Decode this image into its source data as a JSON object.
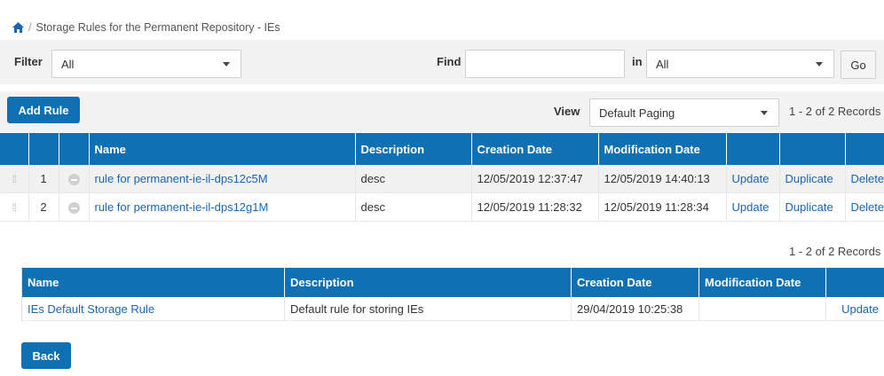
{
  "breadcrumb": {
    "separator": "/",
    "title": "Storage Rules for the Permanent Repository - IEs"
  },
  "filter": {
    "label": "Filter",
    "value": "All"
  },
  "find": {
    "label": "Find",
    "value": "",
    "in_label": "in",
    "in_value": "All",
    "go_label": "Go"
  },
  "toolbar": {
    "add_rule_label": "Add Rule",
    "view_label": "View",
    "view_value": "Default Paging",
    "records_top": "1 - 2 of 2 Records"
  },
  "rules_table": {
    "headers": [
      "Name",
      "Description",
      "Creation Date",
      "Modification Date"
    ],
    "rows": [
      {
        "index": "1",
        "name": "rule for permanent-ie-il-dps12c5M",
        "description": "desc",
        "created": "12/05/2019 12:37:47",
        "modified": "12/05/2019 14:40:13",
        "update": "Update",
        "duplicate": "Duplicate",
        "delete": "Delete"
      },
      {
        "index": "2",
        "name": "rule for permanent-ie-il-dps12g1M",
        "description": "desc",
        "created": "12/05/2019 11:28:32",
        "modified": "12/05/2019 11:28:34",
        "update": "Update",
        "duplicate": "Duplicate",
        "delete": "Delete"
      }
    ]
  },
  "records_bottom": "1 - 2 of 2 Records",
  "default_table": {
    "headers": [
      "Name",
      "Description",
      "Creation Date",
      "Modification Date"
    ],
    "rows": [
      {
        "name": "IEs Default Storage Rule",
        "description": "Default rule for storing IEs",
        "created": "29/04/2019 10:25:38",
        "modified": "",
        "update": "Update"
      }
    ]
  },
  "back_label": "Back",
  "colors": {
    "accent": "#0f71b4",
    "link": "#1a64b5",
    "toolbar_bg": "#f2f2f2"
  },
  "icons": {
    "home": "home-icon",
    "drag": "drag-handle-icon",
    "status": "minus-circle-icon",
    "dropdown": "chevron-down-icon"
  }
}
